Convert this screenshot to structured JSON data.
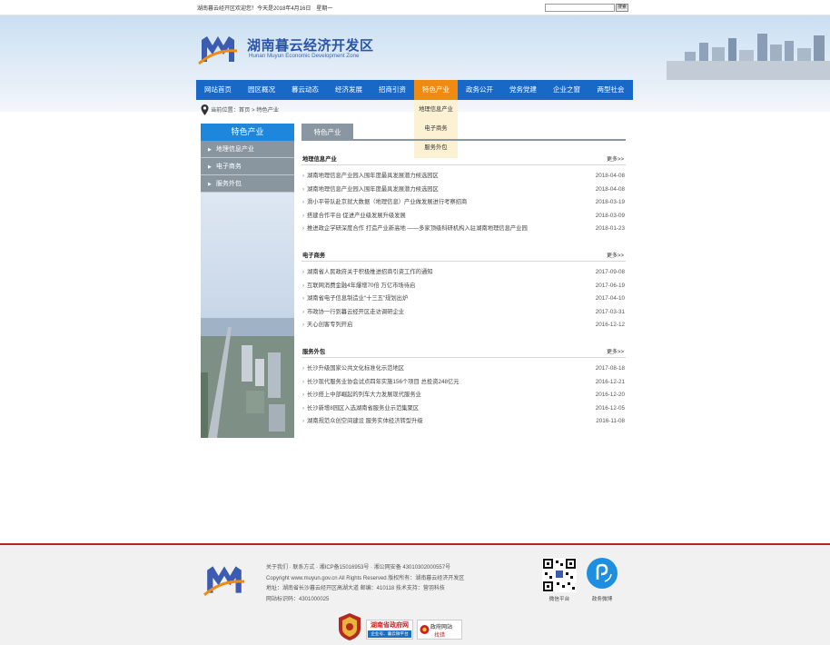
{
  "topbar": {
    "welcome": "湖南暮云经开区欢迎您！今天是2018年4月16日　星期一",
    "search_placeholder": "",
    "search_button": "搜索"
  },
  "header": {
    "title": "湖南暮云经济开发区",
    "subtitle": "Hunan Muyun Economic Development Zone"
  },
  "nav": {
    "items": [
      {
        "label": "网站首页"
      },
      {
        "label": "园区概况"
      },
      {
        "label": "暮云动态"
      },
      {
        "label": "经济发展"
      },
      {
        "label": "招商引资"
      },
      {
        "label": "特色产业"
      },
      {
        "label": "政务公开"
      },
      {
        "label": "党务党建"
      },
      {
        "label": "企业之窗"
      },
      {
        "label": "两型社会"
      }
    ],
    "active_index": 5,
    "active_color": "#f08b12",
    "bar_color": "#1868c8"
  },
  "dropdown": {
    "items": [
      "地理信息产业",
      "电子商务",
      "服务外包"
    ]
  },
  "breadcrumb": {
    "text": "当前位置：首页 > 特色产业"
  },
  "sidebar": {
    "title": "特色产业",
    "items": [
      "地理信息产业",
      "电子商务",
      "服务外包"
    ]
  },
  "main": {
    "tab": "特色产业",
    "more_label": "更多>>",
    "sections": [
      {
        "title": "地理信息产业",
        "news": [
          {
            "title": "湖南地理信息产业园入围年度最具发展潜力候选园区",
            "date": "2018-04-08"
          },
          {
            "title": "湖南地理信息产业园入围年度最具发展潜力候选园区",
            "date": "2018-04-08"
          },
          {
            "title": "滑小平带队赴京就大数据（地理信息）产业做发展进行考察招商",
            "date": "2018-03-19"
          },
          {
            "title": "搭建合作平台 促进产业级发展升级发展",
            "date": "2018-03-09"
          },
          {
            "title": "推进政企学研深度合作 打造产业新高地 ——多家顶级科研机构入驻湖南地理信息产业园",
            "date": "2018-01-23"
          }
        ]
      },
      {
        "title": "电子商务",
        "news": [
          {
            "title": "湖南省人民政府关于积极推进招商引资工作的通知",
            "date": "2017-09-08"
          },
          {
            "title": "互联网消费金融4年爆增70倍 万亿市场待启",
            "date": "2017-06-19"
          },
          {
            "title": "湖南省电子信息制造业“十三五”规划出炉",
            "date": "2017-04-10"
          },
          {
            "title": "市政协一行到暮云经开区走访调研企业",
            "date": "2017-03-31"
          },
          {
            "title": "天心创客专列开启",
            "date": "2016-12-12"
          }
        ]
      },
      {
        "title": "服务外包",
        "news": [
          {
            "title": "长沙升级国家公共文化标准化示范地区",
            "date": "2017-08-18"
          },
          {
            "title": "长沙现代服务业协会试点四年实施156个项目 总投资248亿元",
            "date": "2016-12-21"
          },
          {
            "title": "长沙搭上中部崛起的列车大力发展现代服务业",
            "date": "2016-12-20"
          },
          {
            "title": "长沙新增8园区入选湖南省服务业示范集聚区",
            "date": "2016-12-05"
          },
          {
            "title": "湖南规范众创空间建设 服务实体经济转型升级",
            "date": "2016-11-08"
          }
        ]
      }
    ]
  },
  "footer": {
    "lines": [
      "关于我们 · 联系方式 · 湘ICP备15016953号 · 湘公网安备 43010302000557号",
      "Copyright www.muyun.gov.cn All Rights Reserved  版权所有：湖南暮云经济开发区",
      "地址：湖南省长沙暮云经开区高湖大道  邮编：410118  技术支持：营羽科技",
      "网站标识码：4301000025"
    ],
    "qr_label": "微信平台",
    "weibo_label": "政务微博",
    "badge_gov": "湖南省政府网",
    "badge_gov_sub": "企业号、暮云微平台",
    "badge_error_title": "政府网站",
    "badge_error_sub": "找错"
  }
}
